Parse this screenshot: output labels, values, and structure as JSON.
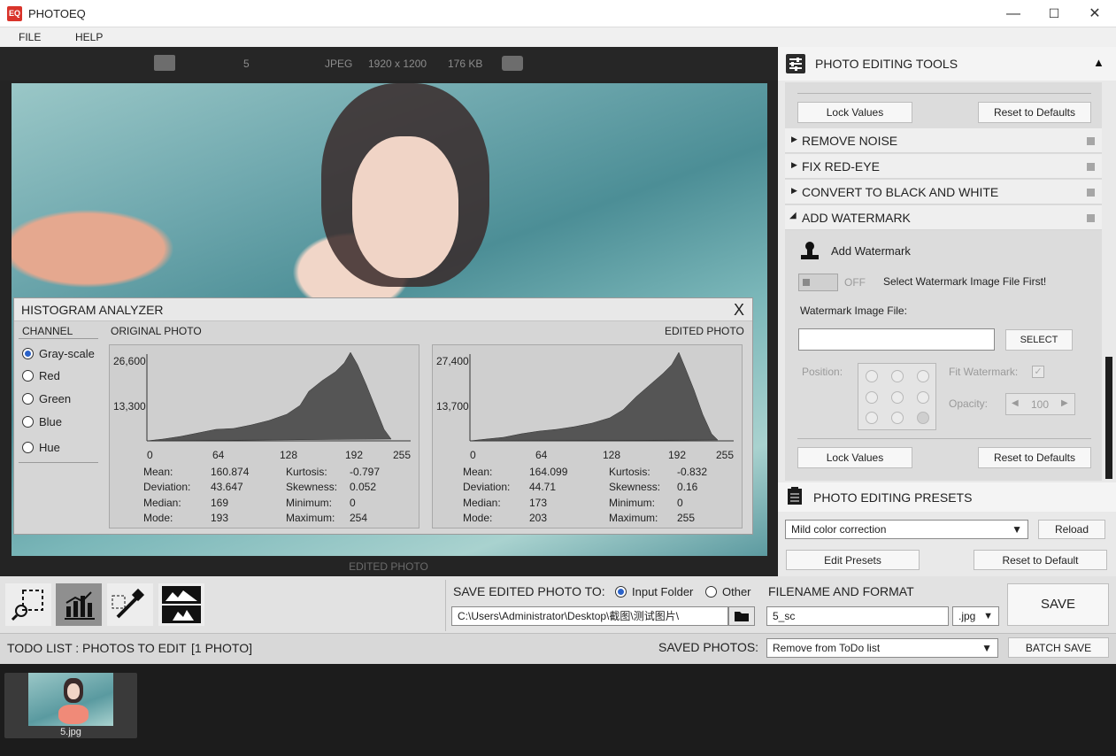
{
  "window": {
    "title": "PHOTOEQ",
    "icon_text": "EQ",
    "minimize": "—",
    "maximize": "☐",
    "close": "✕"
  },
  "menu": {
    "file": "FILE",
    "help": "HELP"
  },
  "infobar": {
    "count": "5",
    "format": "JPEG",
    "dimensions": "1920 x 1200",
    "size": "176 KB"
  },
  "viewer": {
    "edited_label": "EDITED PHOTO"
  },
  "histogram": {
    "title": "HISTOGRAM ANALYZER",
    "close": "X",
    "channel_label": "CHANNEL",
    "channels": [
      "Gray-scale",
      "Red",
      "Green",
      "Blue",
      "Hue"
    ],
    "selected_channel": "Gray-scale",
    "original": {
      "label": "ORIGINAL PHOTO",
      "y_ticks": [
        "26,600",
        "13,300"
      ],
      "x_ticks": [
        "0",
        "64",
        "128",
        "192",
        "255"
      ],
      "stats": {
        "mean_label": "Mean:",
        "mean": "160.874",
        "deviation_label": "Deviation:",
        "deviation": "43.647",
        "median_label": "Median:",
        "median": "169",
        "mode_label": "Mode:",
        "mode": "193",
        "kurtosis_label": "Kurtosis:",
        "kurtosis": "-0.797",
        "skewness_label": "Skewness:",
        "skewness": "0.052",
        "minimum_label": "Minimum:",
        "minimum": "0",
        "maximum_label": "Maximum:",
        "maximum": "254"
      }
    },
    "edited": {
      "label": "EDITED PHOTO",
      "y_ticks": [
        "27,400",
        "13,700"
      ],
      "x_ticks": [
        "0",
        "64",
        "128",
        "192",
        "255"
      ],
      "stats": {
        "mean_label": "Mean:",
        "mean": "164.099",
        "deviation_label": "Deviation:",
        "deviation": "44.71",
        "median_label": "Median:",
        "median": "173",
        "mode_label": "Mode:",
        "mode": "203",
        "kurtosis_label": "Kurtosis:",
        "kurtosis": "-0.832",
        "skewness_label": "Skewness:",
        "skewness": "0.16",
        "minimum_label": "Minimum:",
        "minimum": "0",
        "maximum_label": "Maximum:",
        "maximum": "255"
      }
    }
  },
  "tools": {
    "header": "PHOTO EDITING TOOLS",
    "lock_values": "Lock Values",
    "reset_defaults": "Reset to Defaults",
    "items": [
      "REMOVE NOISE",
      "FIX RED-EYE",
      "CONVERT TO BLACK AND WHITE",
      "ADD WATERMARK"
    ],
    "watermark": {
      "title": "Add Watermark",
      "toggle_state": "OFF",
      "hint": "Select Watermark Image File First!",
      "file_label": "Watermark Image File:",
      "file_value": "",
      "select_button": "SELECT",
      "position_label": "Position:",
      "fit_label": "Fit Watermark:",
      "opacity_label": "Opacity:",
      "opacity_value": "100"
    }
  },
  "presets": {
    "header": "PHOTO EDITING PRESETS",
    "selected": "Mild color correction",
    "reload": "Reload",
    "edit": "Edit Presets",
    "reset": "Reset to Default"
  },
  "save": {
    "label": "SAVE EDITED PHOTO TO:",
    "input_folder": "Input Folder",
    "other": "Other",
    "path": "C:\\Users\\Administrator\\Desktop\\截图\\测试图片\\",
    "filename_label": "FILENAME AND FORMAT",
    "filename": "5_sc",
    "format": ".jpg",
    "save_button": "SAVE"
  },
  "todo": {
    "label": "TODO LIST : PHOTOS TO EDIT",
    "count": "[1 PHOTO]",
    "saved_label": "SAVED PHOTOS:",
    "saved_option": "Remove from ToDo list",
    "batch_save": "BATCH SAVE",
    "items": [
      {
        "name": "5.jpg"
      }
    ]
  },
  "colors": {
    "accent": "#2a62c9",
    "titlebar_icon": "#d9342b",
    "dark_bg": "#1e1e1e"
  }
}
